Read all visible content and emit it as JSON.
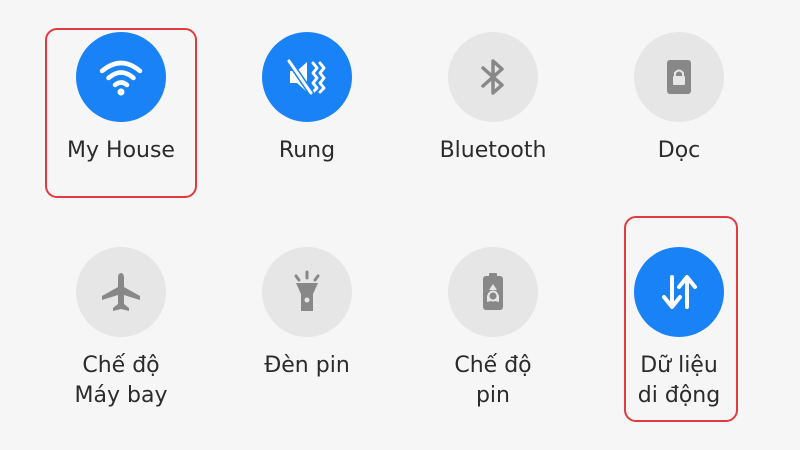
{
  "tiles": [
    {
      "label_lines": [
        "My House"
      ],
      "icon": "wifi-icon",
      "active": true
    },
    {
      "label_lines": [
        "Rung"
      ],
      "icon": "vibrate-icon",
      "active": true
    },
    {
      "label_lines": [
        "Bluetooth"
      ],
      "icon": "bluetooth-icon",
      "active": false
    },
    {
      "label_lines": [
        "Dọc"
      ],
      "icon": "portrait-lock-icon",
      "active": false
    },
    {
      "label_lines": [
        "Chế độ",
        "Máy bay"
      ],
      "icon": "airplane-icon",
      "active": false
    },
    {
      "label_lines": [
        "Đèn pin"
      ],
      "icon": "flashlight-icon",
      "active": false
    },
    {
      "label_lines": [
        "Chế độ",
        "pin"
      ],
      "icon": "battery-saver-icon",
      "active": false
    },
    {
      "label_lines": [
        "Dữ liệu",
        "di động"
      ],
      "icon": "mobile-data-icon",
      "active": true
    }
  ],
  "colors": {
    "active": "#1a82f7",
    "inactive": "#e6e6e6",
    "icon_inactive": "#888888",
    "highlight": "#e23a3e"
  }
}
